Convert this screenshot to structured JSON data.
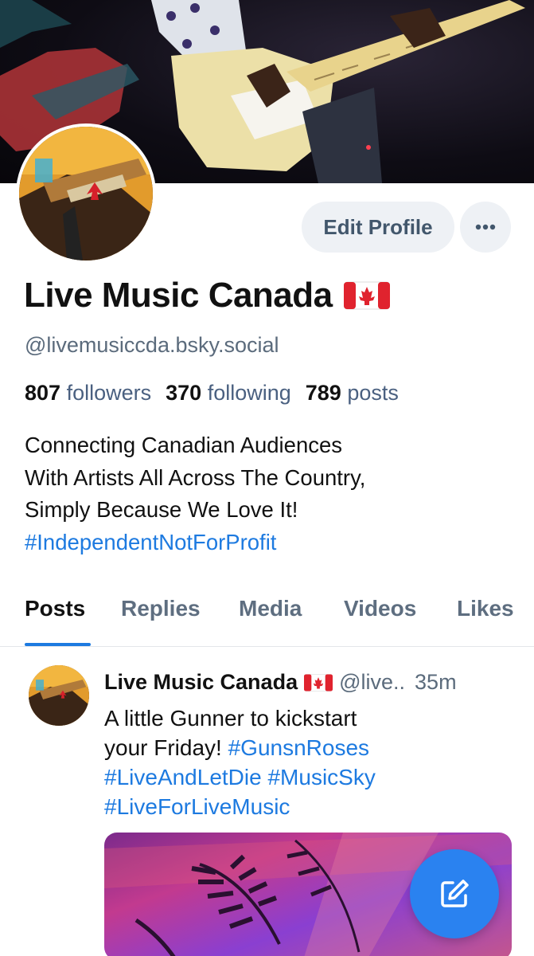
{
  "profile": {
    "display_name": "Live Music Canada",
    "handle": "@livemusiccda.bsky.social",
    "followers_count": "807",
    "followers_label": "followers",
    "following_count": "370",
    "following_label": "following",
    "posts_count": "789",
    "posts_label": "posts",
    "bio_lines": [
      "Connecting Canadian Audiences",
      "With Artists All Across The Country,",
      "Simply Because We Love It!"
    ],
    "bio_hashtag": "#IndependentNotForProfit"
  },
  "actions": {
    "edit_profile_label": "Edit Profile"
  },
  "tabs": [
    {
      "label": "Posts",
      "active": true
    },
    {
      "label": "Replies",
      "active": false
    },
    {
      "label": "Media",
      "active": false
    },
    {
      "label": "Videos",
      "active": false
    },
    {
      "label": "Likes",
      "active": false
    }
  ],
  "post": {
    "author_name": "Live Music Canada",
    "author_handle": "@live..",
    "time": "35m",
    "text_line1": "A little Gunner to kickstart",
    "text_line2_plain": "your Friday! ",
    "text_line2_tag": "#GunsnRoses",
    "text_line3": "#LiveAndLetDie #MusicSky",
    "text_line4": "#LiveForLiveMusic"
  },
  "icons": {
    "flag": "canada-flag-icon",
    "more": "ellipsis-icon",
    "compose": "compose-icon"
  },
  "colors": {
    "accent": "#1d7ae0",
    "fab": "#2a82f0",
    "button_bg": "#eef1f5",
    "muted_text": "#5b6b7c"
  }
}
